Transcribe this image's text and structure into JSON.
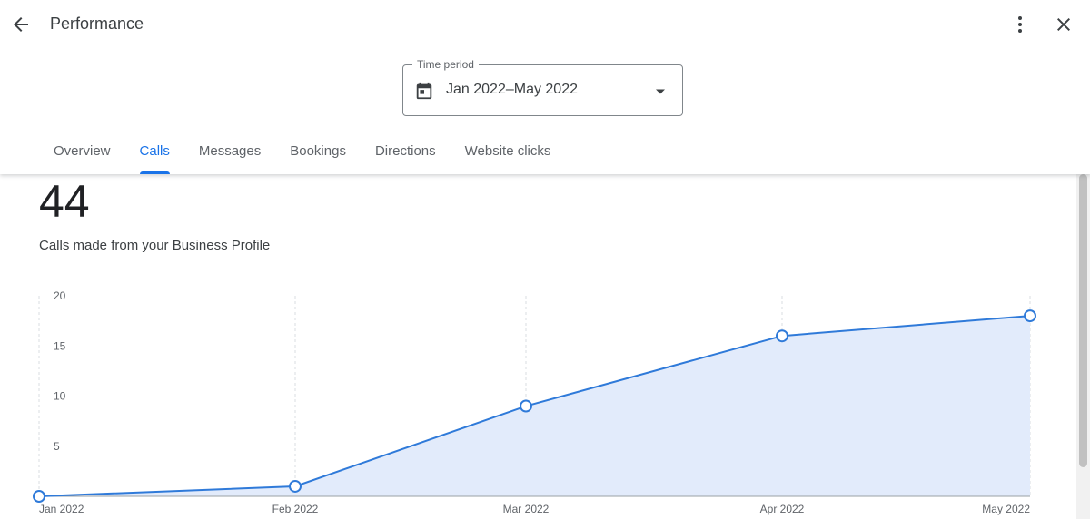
{
  "header": {
    "title": "Performance",
    "back_icon": "arrow-back-icon",
    "more_icon": "more-vert-icon",
    "close_icon": "close-icon"
  },
  "time_period": {
    "label": "Time period",
    "value": "Jan 2022–May 2022",
    "icon": "calendar-icon"
  },
  "tabs": [
    {
      "label": "Overview",
      "active": false
    },
    {
      "label": "Calls",
      "active": true
    },
    {
      "label": "Messages",
      "active": false
    },
    {
      "label": "Bookings",
      "active": false
    },
    {
      "label": "Directions",
      "active": false
    },
    {
      "label": "Website clicks",
      "active": false
    }
  ],
  "summary": {
    "total": "44",
    "description": "Calls made from your Business Profile"
  },
  "colors": {
    "accent": "#1a73e8",
    "line": "#2f7ad9",
    "area": "#e2ebfb"
  },
  "chart_data": {
    "type": "area",
    "categories": [
      "Jan 2022",
      "Feb 2022",
      "Mar 2022",
      "Apr 2022",
      "May 2022"
    ],
    "values": [
      0,
      1,
      9,
      16,
      18
    ],
    "yticks": [
      5,
      10,
      15,
      20
    ],
    "ylim": [
      0,
      20
    ],
    "grid": "vertical dashed"
  }
}
